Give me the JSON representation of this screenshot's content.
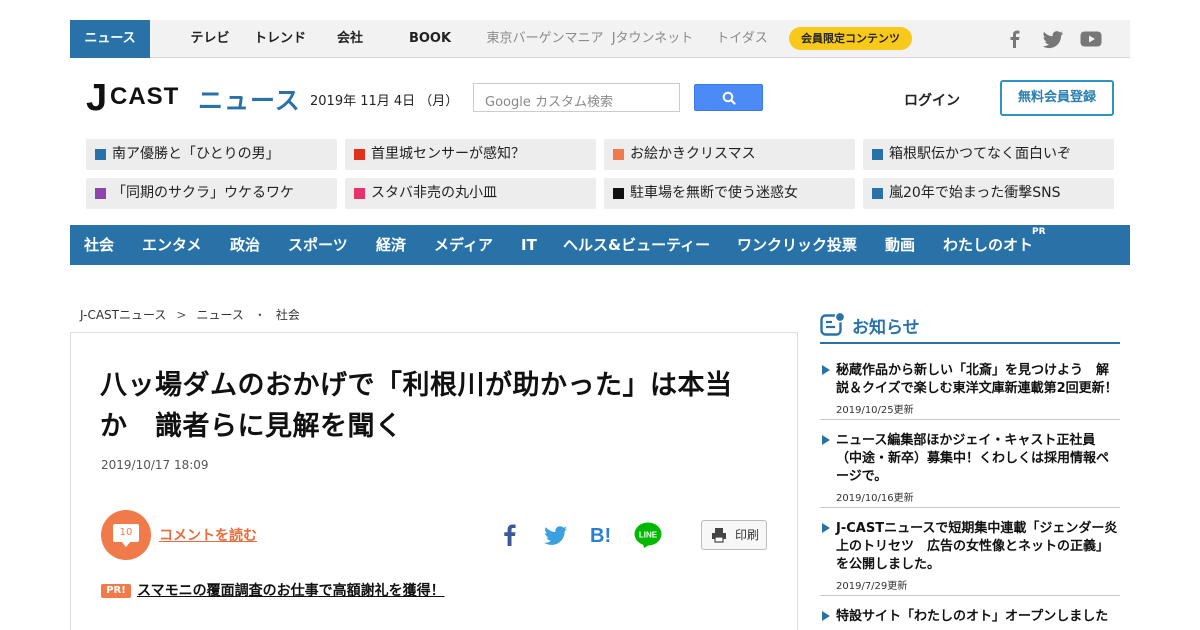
{
  "topnav": {
    "items": [
      "ニュース",
      "テレビ",
      "トレンド",
      "会社",
      "BOOK",
      "東京バーゲンマニア",
      "Jタウンネット",
      "トイダス"
    ],
    "badge": "会員限定コンテンツ",
    "social": [
      "facebook-icon",
      "twitter-icon",
      "youtube-icon"
    ]
  },
  "header": {
    "logo_j": "J",
    "logo_cast": "CAST",
    "logo_news": "ニュース",
    "date": "2019年 11月 4日 （月）",
    "search_placeholder": "Google カスタム検索",
    "login": "ログイン",
    "register": "無料会員登録"
  },
  "tags": [
    {
      "label": "南ア優勝と「ひとりの男」",
      "color": "#2872a8"
    },
    {
      "label": "首里城センサーが感知？",
      "color": "#e0301e"
    },
    {
      "label": "お絵かきクリスマス",
      "color": "#f07a4a"
    },
    {
      "label": "箱根駅伝かつてなく面白いぞ",
      "color": "#2872a8"
    },
    {
      "label": "「同期のサクラ」ウケるワケ",
      "color": "#8e44ad"
    },
    {
      "label": "スタバ非売の丸小皿",
      "color": "#e8326e"
    },
    {
      "label": "駐車場を無断で使う迷惑女",
      "color": "#111111"
    },
    {
      "label": "嵐20年で始まった衝撃SNS",
      "color": "#2872a8"
    }
  ],
  "categories": [
    "社会",
    "エンタメ",
    "政治",
    "スポーツ",
    "経済",
    "メディア",
    "IT",
    "ヘルス&ビューティー",
    "ワンクリック投票",
    "動画",
    "わたしのオト"
  ],
  "category_pr": "PR",
  "breadcrumb": [
    "J-CASTニュース",
    "ニュース",
    "社会"
  ],
  "breadcrumb_seps": [
    ">",
    "・"
  ],
  "article": {
    "title_line1": "八ッ場ダムのおかげで「利根川が助かった」は本当",
    "title_line2": "か　識者らに見解を聞く",
    "date": "2019/10/17 18:09",
    "comment_count": "10",
    "comment_link": "コメントを読む",
    "print": "印刷",
    "pr_badge": "PR!",
    "pr_link": "スマモニの覆面調査のお仕事で高額謝礼を獲得！"
  },
  "sidebar": {
    "heading": "お知らせ",
    "items": [
      {
        "lines": [
          "秘蔵作品から新しい「北斎」を見つけよう　解",
          "説＆クイズで楽しむ東洋文庫新連載第2回更新！"
        ],
        "date": "2019/10/25更新"
      },
      {
        "lines": [
          "ニュース編集部ほかジェイ・キャスト正社員",
          "（中途・新卒）募集中！くわしくは採用情報ペ",
          "ージで。"
        ],
        "date": "2019/10/16更新"
      },
      {
        "lines": [
          "J-CASTニュースで短期集中連載「ジェンダー炎",
          "上のトリセツ　広告の女性像とネットの正義」",
          "を公開しました。"
        ],
        "date": "2019/7/29更新"
      },
      {
        "lines": [
          "特設サイト「わたしのオト」オープンしました"
        ],
        "date": ""
      }
    ]
  }
}
